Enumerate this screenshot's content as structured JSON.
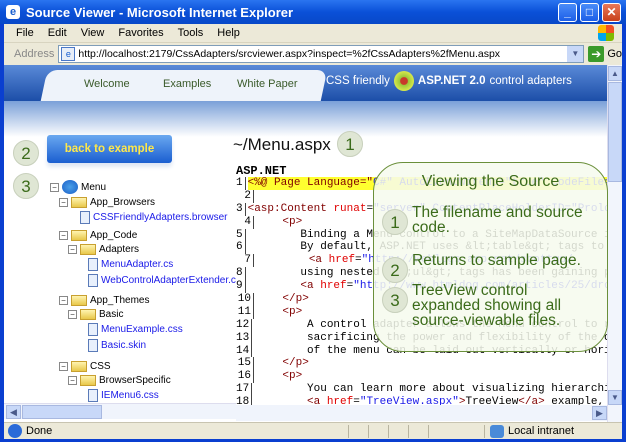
{
  "window": {
    "title": "Source Viewer - Microsoft Internet Explorer",
    "controls": [
      "minimize",
      "maximize",
      "close"
    ]
  },
  "menu": [
    "File",
    "Edit",
    "View",
    "Favorites",
    "Tools",
    "Help"
  ],
  "address": {
    "label": "Address",
    "url": "http://localhost:2179/CssAdapters/srcviewer.aspx?inspect=%2fCssAdapters%2fMenu.aspx",
    "go": "Go"
  },
  "nav": {
    "tabs": [
      "Welcome",
      "Examples",
      "White Paper"
    ],
    "brand_pre": "CSS friendly",
    "brand_bold": "ASP.NET 2.0",
    "brand_post": "control adapters"
  },
  "back_button": "back to example",
  "badges": [
    "1",
    "2",
    "3"
  ],
  "tree": [
    {
      "label": "Menu",
      "type": "root"
    },
    {
      "label": "App_Browsers",
      "type": "folder"
    },
    {
      "label": "CSSFriendlyAdapters.browser",
      "type": "file"
    },
    {
      "label": "App_Code",
      "type": "folder"
    },
    {
      "label": "Adapters",
      "type": "folder"
    },
    {
      "label": "MenuAdapter.cs",
      "type": "file"
    },
    {
      "label": "WebControlAdapterExtender.cs",
      "type": "file"
    },
    {
      "label": "App_Themes",
      "type": "folder"
    },
    {
      "label": "Basic",
      "type": "folder"
    },
    {
      "label": "MenuExample.css",
      "type": "file"
    },
    {
      "label": "Basic.skin",
      "type": "file"
    },
    {
      "label": "CSS",
      "type": "folder"
    },
    {
      "label": "BrowserSpecific",
      "type": "folder"
    },
    {
      "label": "IEMenu6.css",
      "type": "file"
    }
  ],
  "source": {
    "filename": "~/Menu.aspx",
    "language": "ASP.NET",
    "lines": [
      [
        [
          "tg",
          "<%@ Page Language=\""
        ],
        [
          "st",
          "C#\" AutoEventWireup=\"true\" CodeFile=\""
        ]
      ],
      [
        [
          "tx",
          ""
        ]
      ],
      [
        [
          "tg",
          "<asp:Content "
        ],
        [
          "at",
          "runat"
        ],
        [
          "tx",
          "="
        ],
        [
          "st",
          "\"server\" ContentPlaceHolderID=\"Prolo"
        ]
      ],
      [
        [
          "tx",
          "    "
        ],
        [
          "tg",
          "<p>"
        ]
      ],
      [
        [
          "tx",
          "        Binding a Menu control to a SiteMapDataSource i"
        ]
      ],
      [
        [
          "tx",
          "        By default, ASP.NET uses &lt;table&gt; tags to "
        ]
      ],
      [
        [
          "tx",
          "        "
        ],
        [
          "tg",
          "<a "
        ],
        [
          "at",
          "href"
        ],
        [
          "tx",
          "="
        ],
        [
          "st",
          "\"http://weblogs.asp.net/scottgu/"
        ]
      ],
      [
        [
          "tx",
          "        using nested &lt;ul&gt; tags has been gaining p"
        ]
      ],
      [
        [
          "tx",
          "        "
        ],
        [
          "tg",
          "<a "
        ],
        [
          "at",
          "href"
        ],
        [
          "tx",
          "="
        ],
        [
          "st",
          "\"http://www.htmldog.com/articles/25/drop-d"
        ]
      ],
      [
        [
          "tx",
          "    "
        ],
        [
          "tg",
          "</p>"
        ]
      ],
      [
        [
          "tx",
          "    "
        ],
        [
          "tg",
          "<p>"
        ]
      ],
      [
        [
          "tx",
          "        A control adapter allows the Menu control to r"
        ]
      ],
      [
        [
          "tx",
          "        sacrificing the power and flexibility of the or"
        ]
      ],
      [
        [
          "tx",
          "        of the menu can be laid out vertically or horiz"
        ]
      ],
      [
        [
          "tx",
          "    "
        ],
        [
          "tg",
          "</p>"
        ]
      ],
      [
        [
          "tx",
          "    "
        ],
        [
          "tg",
          "<p>"
        ]
      ],
      [
        [
          "tx",
          "        You can learn more about visualizing hierarchic"
        ]
      ],
      [
        [
          "tx",
          "        "
        ],
        [
          "tg",
          "<a "
        ],
        [
          "at",
          "href"
        ],
        [
          "tx",
          "="
        ],
        [
          "st",
          "\"TreeView.aspx\""
        ],
        [
          "tg",
          ">"
        ],
        [
          "tx",
          "TreeView"
        ],
        [
          "tg",
          "</a>"
        ],
        [
          "tx",
          " example, t"
        ]
      ]
    ]
  },
  "callout": {
    "title": "Viewing the Source",
    "items": [
      {
        "n": "1",
        "text": "The filename and source code."
      },
      {
        "n": "2",
        "text": "Returns to sample page."
      },
      {
        "n": "3",
        "text": "TreeView control expanded showing all source-viewable files."
      }
    ]
  },
  "status": {
    "text": "Done",
    "zone": "Local intranet"
  }
}
